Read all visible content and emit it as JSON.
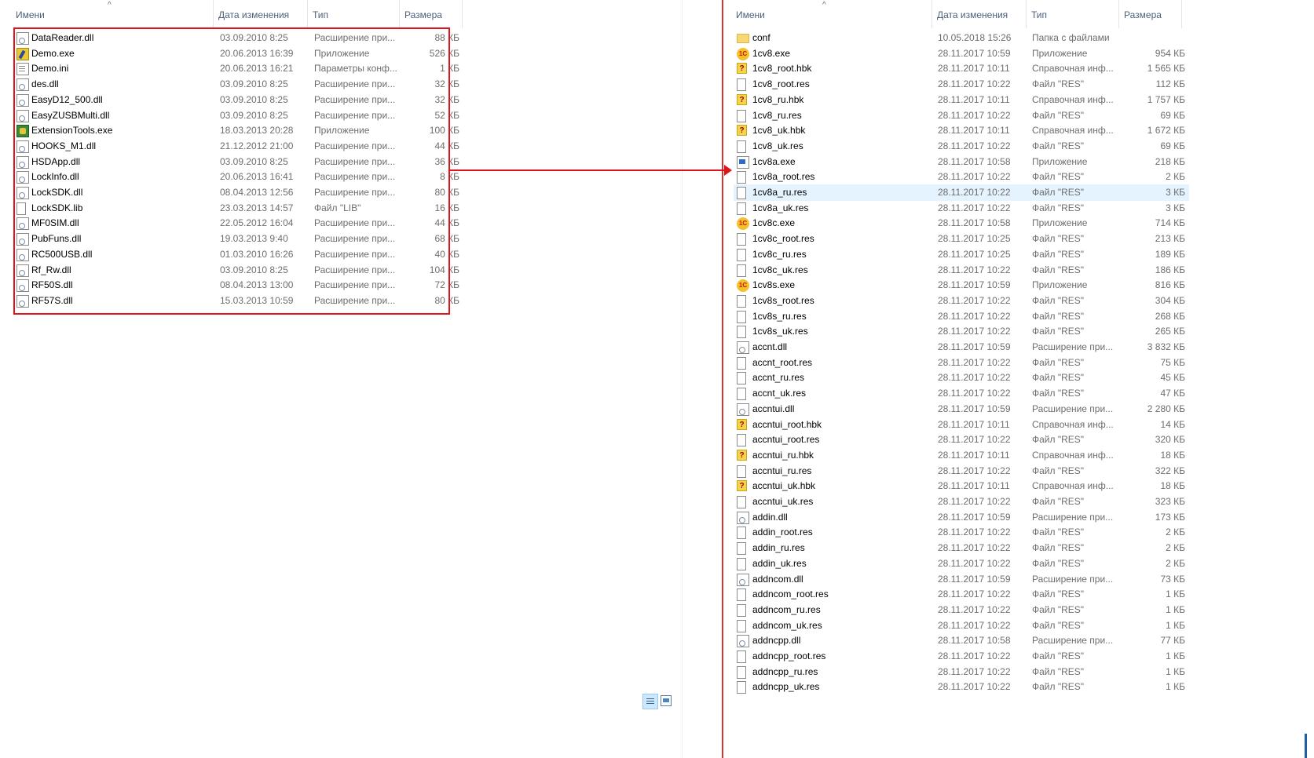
{
  "left_panel": {
    "columns": {
      "name": "Имени",
      "date": "Дата изменения",
      "type": "Тип",
      "size": "Размера"
    },
    "files": [
      {
        "name": "DataReader.dll",
        "date": "03.09.2010 8:25",
        "type": "Расширение при...",
        "size": "88 КБ",
        "icon": "dll-icon"
      },
      {
        "name": "Demo.exe",
        "date": "20.06.2013 16:39",
        "type": "Приложение",
        "size": "526 КБ",
        "icon": "demo-app-icon"
      },
      {
        "name": "Demo.ini",
        "date": "20.06.2013 16:21",
        "type": "Параметры конф...",
        "size": "1 КБ",
        "icon": "ini-icon"
      },
      {
        "name": "des.dll",
        "date": "03.09.2010 8:25",
        "type": "Расширение при...",
        "size": "32 КБ",
        "icon": "dll-icon"
      },
      {
        "name": "EasyD12_500.dll",
        "date": "03.09.2010 8:25",
        "type": "Расширение при...",
        "size": "32 КБ",
        "icon": "dll-icon"
      },
      {
        "name": "EasyZUSBMulti.dll",
        "date": "03.09.2010 8:25",
        "type": "Расширение при...",
        "size": "52 КБ",
        "icon": "dll-icon"
      },
      {
        "name": "ExtensionTools.exe",
        "date": "18.03.2013 20:28",
        "type": "Приложение",
        "size": "100 КБ",
        "icon": "app-icon"
      },
      {
        "name": "HOOKS_M1.dll",
        "date": "21.12.2012 21:00",
        "type": "Расширение при...",
        "size": "44 КБ",
        "icon": "dll-icon"
      },
      {
        "name": "HSDApp.dll",
        "date": "03.09.2010 8:25",
        "type": "Расширение при...",
        "size": "36 КБ",
        "icon": "dll-icon"
      },
      {
        "name": "LockInfo.dll",
        "date": "20.06.2013 16:41",
        "type": "Расширение при...",
        "size": "8 КБ",
        "icon": "dll-icon"
      },
      {
        "name": "LockSDK.dll",
        "date": "08.04.2013 12:56",
        "type": "Расширение при...",
        "size": "80 КБ",
        "icon": "dll-icon"
      },
      {
        "name": "LockSDK.lib",
        "date": "23.03.2013 14:57",
        "type": "Файл \"LIB\"",
        "size": "16 КБ",
        "icon": "file-icon"
      },
      {
        "name": "MF0SIM.dll",
        "date": "22.05.2012 16:04",
        "type": "Расширение при...",
        "size": "44 КБ",
        "icon": "dll-icon"
      },
      {
        "name": "PubFuns.dll",
        "date": "19.03.2013 9:40",
        "type": "Расширение при...",
        "size": "68 КБ",
        "icon": "dll-icon"
      },
      {
        "name": "RC500USB.dll",
        "date": "01.03.2010 16:26",
        "type": "Расширение при...",
        "size": "40 КБ",
        "icon": "dll-icon"
      },
      {
        "name": "Rf_Rw.dll",
        "date": "03.09.2010 8:25",
        "type": "Расширение при...",
        "size": "104 КБ",
        "icon": "dll-icon"
      },
      {
        "name": "RF50S.dll",
        "date": "08.04.2013 13:00",
        "type": "Расширение при...",
        "size": "72 КБ",
        "icon": "dll-icon"
      },
      {
        "name": "RF57S.dll",
        "date": "15.03.2013 10:59",
        "type": "Расширение при...",
        "size": "80 КБ",
        "icon": "dll-icon"
      }
    ]
  },
  "right_panel": {
    "columns": {
      "name": "Имени",
      "date": "Дата изменения",
      "type": "Тип",
      "size": "Размера"
    },
    "files": [
      {
        "name": "conf",
        "date": "10.05.2018 15:26",
        "type": "Папка с файлами",
        "size": "",
        "icon": "folder-icon"
      },
      {
        "name": "1cv8.exe",
        "date": "28.11.2017 10:59",
        "type": "Приложение",
        "size": "954 КБ",
        "icon": "1c-icon"
      },
      {
        "name": "1cv8_root.hbk",
        "date": "28.11.2017 10:11",
        "type": "Справочная инф...",
        "size": "1 565 КБ",
        "icon": "help-icon"
      },
      {
        "name": "1cv8_root.res",
        "date": "28.11.2017 10:22",
        "type": "Файл \"RES\"",
        "size": "112 КБ",
        "icon": "file-icon"
      },
      {
        "name": "1cv8_ru.hbk",
        "date": "28.11.2017 10:11",
        "type": "Справочная инф...",
        "size": "1 757 КБ",
        "icon": "help-icon"
      },
      {
        "name": "1cv8_ru.res",
        "date": "28.11.2017 10:22",
        "type": "Файл \"RES\"",
        "size": "69 КБ",
        "icon": "file-icon"
      },
      {
        "name": "1cv8_uk.hbk",
        "date": "28.11.2017 10:11",
        "type": "Справочная инф...",
        "size": "1 672 КБ",
        "icon": "help-icon"
      },
      {
        "name": "1cv8_uk.res",
        "date": "28.11.2017 10:22",
        "type": "Файл \"RES\"",
        "size": "69 КБ",
        "icon": "file-icon"
      },
      {
        "name": "1cv8a.exe",
        "date": "28.11.2017 10:58",
        "type": "Приложение",
        "size": "218 КБ",
        "icon": "exe-icon"
      },
      {
        "name": "1cv8a_root.res",
        "date": "28.11.2017 10:22",
        "type": "Файл \"RES\"",
        "size": "2 КБ",
        "icon": "file-icon"
      },
      {
        "name": "1cv8a_ru.res",
        "date": "28.11.2017 10:22",
        "type": "Файл \"RES\"",
        "size": "3 КБ",
        "icon": "file-icon",
        "selected": true
      },
      {
        "name": "1cv8a_uk.res",
        "date": "28.11.2017 10:22",
        "type": "Файл \"RES\"",
        "size": "3 КБ",
        "icon": "file-icon"
      },
      {
        "name": "1cv8c.exe",
        "date": "28.11.2017 10:58",
        "type": "Приложение",
        "size": "714 КБ",
        "icon": "1c-icon"
      },
      {
        "name": "1cv8c_root.res",
        "date": "28.11.2017 10:25",
        "type": "Файл \"RES\"",
        "size": "213 КБ",
        "icon": "file-icon"
      },
      {
        "name": "1cv8c_ru.res",
        "date": "28.11.2017 10:25",
        "type": "Файл \"RES\"",
        "size": "189 КБ",
        "icon": "file-icon"
      },
      {
        "name": "1cv8c_uk.res",
        "date": "28.11.2017 10:22",
        "type": "Файл \"RES\"",
        "size": "186 КБ",
        "icon": "file-icon"
      },
      {
        "name": "1cv8s.exe",
        "date": "28.11.2017 10:59",
        "type": "Приложение",
        "size": "816 КБ",
        "icon": "1c-icon"
      },
      {
        "name": "1cv8s_root.res",
        "date": "28.11.2017 10:22",
        "type": "Файл \"RES\"",
        "size": "304 КБ",
        "icon": "file-icon"
      },
      {
        "name": "1cv8s_ru.res",
        "date": "28.11.2017 10:22",
        "type": "Файл \"RES\"",
        "size": "268 КБ",
        "icon": "file-icon"
      },
      {
        "name": "1cv8s_uk.res",
        "date": "28.11.2017 10:22",
        "type": "Файл \"RES\"",
        "size": "265 КБ",
        "icon": "file-icon"
      },
      {
        "name": "accnt.dll",
        "date": "28.11.2017 10:59",
        "type": "Расширение при...",
        "size": "3 832 КБ",
        "icon": "dll-icon"
      },
      {
        "name": "accnt_root.res",
        "date": "28.11.2017 10:22",
        "type": "Файл \"RES\"",
        "size": "75 КБ",
        "icon": "file-icon"
      },
      {
        "name": "accnt_ru.res",
        "date": "28.11.2017 10:22",
        "type": "Файл \"RES\"",
        "size": "45 КБ",
        "icon": "file-icon"
      },
      {
        "name": "accnt_uk.res",
        "date": "28.11.2017 10:22",
        "type": "Файл \"RES\"",
        "size": "47 КБ",
        "icon": "file-icon"
      },
      {
        "name": "accntui.dll",
        "date": "28.11.2017 10:59",
        "type": "Расширение при...",
        "size": "2 280 КБ",
        "icon": "dll-icon"
      },
      {
        "name": "accntui_root.hbk",
        "date": "28.11.2017 10:11",
        "type": "Справочная инф...",
        "size": "14 КБ",
        "icon": "help-icon"
      },
      {
        "name": "accntui_root.res",
        "date": "28.11.2017 10:22",
        "type": "Файл \"RES\"",
        "size": "320 КБ",
        "icon": "file-icon"
      },
      {
        "name": "accntui_ru.hbk",
        "date": "28.11.2017 10:11",
        "type": "Справочная инф...",
        "size": "18 КБ",
        "icon": "help-icon"
      },
      {
        "name": "accntui_ru.res",
        "date": "28.11.2017 10:22",
        "type": "Файл \"RES\"",
        "size": "322 КБ",
        "icon": "file-icon"
      },
      {
        "name": "accntui_uk.hbk",
        "date": "28.11.2017 10:11",
        "type": "Справочная инф...",
        "size": "18 КБ",
        "icon": "help-icon"
      },
      {
        "name": "accntui_uk.res",
        "date": "28.11.2017 10:22",
        "type": "Файл \"RES\"",
        "size": "323 КБ",
        "icon": "file-icon"
      },
      {
        "name": "addin.dll",
        "date": "28.11.2017 10:59",
        "type": "Расширение при...",
        "size": "173 КБ",
        "icon": "dll-icon"
      },
      {
        "name": "addin_root.res",
        "date": "28.11.2017 10:22",
        "type": "Файл \"RES\"",
        "size": "2 КБ",
        "icon": "file-icon"
      },
      {
        "name": "addin_ru.res",
        "date": "28.11.2017 10:22",
        "type": "Файл \"RES\"",
        "size": "2 КБ",
        "icon": "file-icon"
      },
      {
        "name": "addin_uk.res",
        "date": "28.11.2017 10:22",
        "type": "Файл \"RES\"",
        "size": "2 КБ",
        "icon": "file-icon"
      },
      {
        "name": "addncom.dll",
        "date": "28.11.2017 10:59",
        "type": "Расширение при...",
        "size": "73 КБ",
        "icon": "dll-icon"
      },
      {
        "name": "addncom_root.res",
        "date": "28.11.2017 10:22",
        "type": "Файл \"RES\"",
        "size": "1 КБ",
        "icon": "file-icon"
      },
      {
        "name": "addncom_ru.res",
        "date": "28.11.2017 10:22",
        "type": "Файл \"RES\"",
        "size": "1 КБ",
        "icon": "file-icon"
      },
      {
        "name": "addncom_uk.res",
        "date": "28.11.2017 10:22",
        "type": "Файл \"RES\"",
        "size": "1 КБ",
        "icon": "file-icon"
      },
      {
        "name": "addncpp.dll",
        "date": "28.11.2017 10:58",
        "type": "Расширение при...",
        "size": "77 КБ",
        "icon": "dll-icon"
      },
      {
        "name": "addncpp_root.res",
        "date": "28.11.2017 10:22",
        "type": "Файл \"RES\"",
        "size": "1 КБ",
        "icon": "file-icon"
      },
      {
        "name": "addncpp_ru.res",
        "date": "28.11.2017 10:22",
        "type": "Файл \"RES\"",
        "size": "1 КБ",
        "icon": "file-icon"
      },
      {
        "name": "addncpp_uk.res",
        "date": "28.11.2017 10:22",
        "type": "Файл \"RES\"",
        "size": "1 КБ",
        "icon": "file-icon"
      }
    ]
  },
  "colors": {
    "header_text": "#4c607a",
    "secondary_text": "#6d6d6d",
    "selection": "#e5f3ff",
    "annotation": "#e0121a",
    "divider": "#d4362d"
  },
  "status_bar": {
    "icons": [
      "view-details-icon",
      "view-tiles-icon"
    ]
  }
}
